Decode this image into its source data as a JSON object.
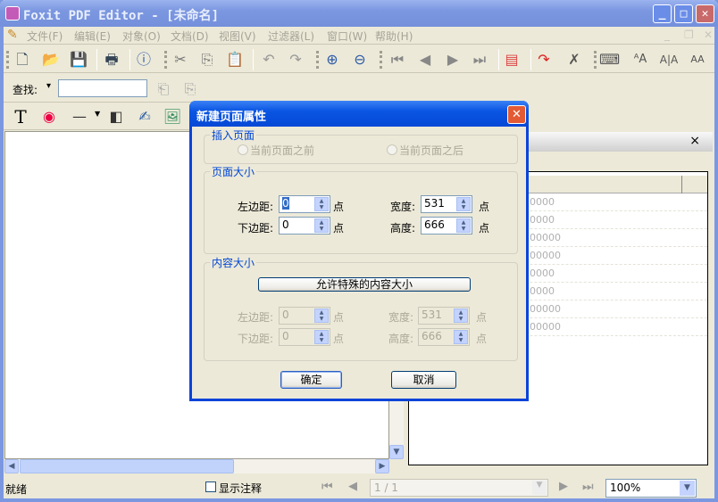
{
  "window": {
    "title": "Foxit PDF Editor - [未命名]",
    "minimize": "_",
    "maximize": "□",
    "close": "✕"
  },
  "menu": [
    "文件(F)",
    "编辑(E)",
    "对象(O)",
    "文档(D)",
    "视图(V)",
    "过滤器(L)",
    "窗口(W)",
    "帮助(H)"
  ],
  "mdi_controls": [
    "_",
    "❐",
    "✕"
  ],
  "find": {
    "label": "查找:",
    "value": "",
    "dropdown": "▾"
  },
  "right_panel": {
    "close": "×",
    "rows": [
      "0000",
      "0000",
      "00000",
      "00000",
      "0000",
      "0000",
      "00000",
      "00000"
    ]
  },
  "status": {
    "ready": "就绪",
    "show_annotations": "显示注释",
    "page": "1 / 1",
    "zoom": "100%"
  },
  "dialog": {
    "title": "新建页面属性",
    "insert_group": "插入页面",
    "before": "当前页面之前",
    "after": "当前页面之后",
    "page_size_group": "页面大小",
    "left_margin": "左边距:",
    "bottom_margin": "下边距:",
    "width": "宽度:",
    "height": "高度:",
    "unit": "点",
    "page_left": "0",
    "page_bottom": "0",
    "page_width": "531",
    "page_height": "666",
    "content_size_group": "内容大小",
    "allow_special": "允许特殊的内容大小",
    "content_left": "0",
    "content_bottom": "0",
    "content_width": "531",
    "content_height": "666",
    "ok": "确定",
    "cancel": "取消"
  }
}
